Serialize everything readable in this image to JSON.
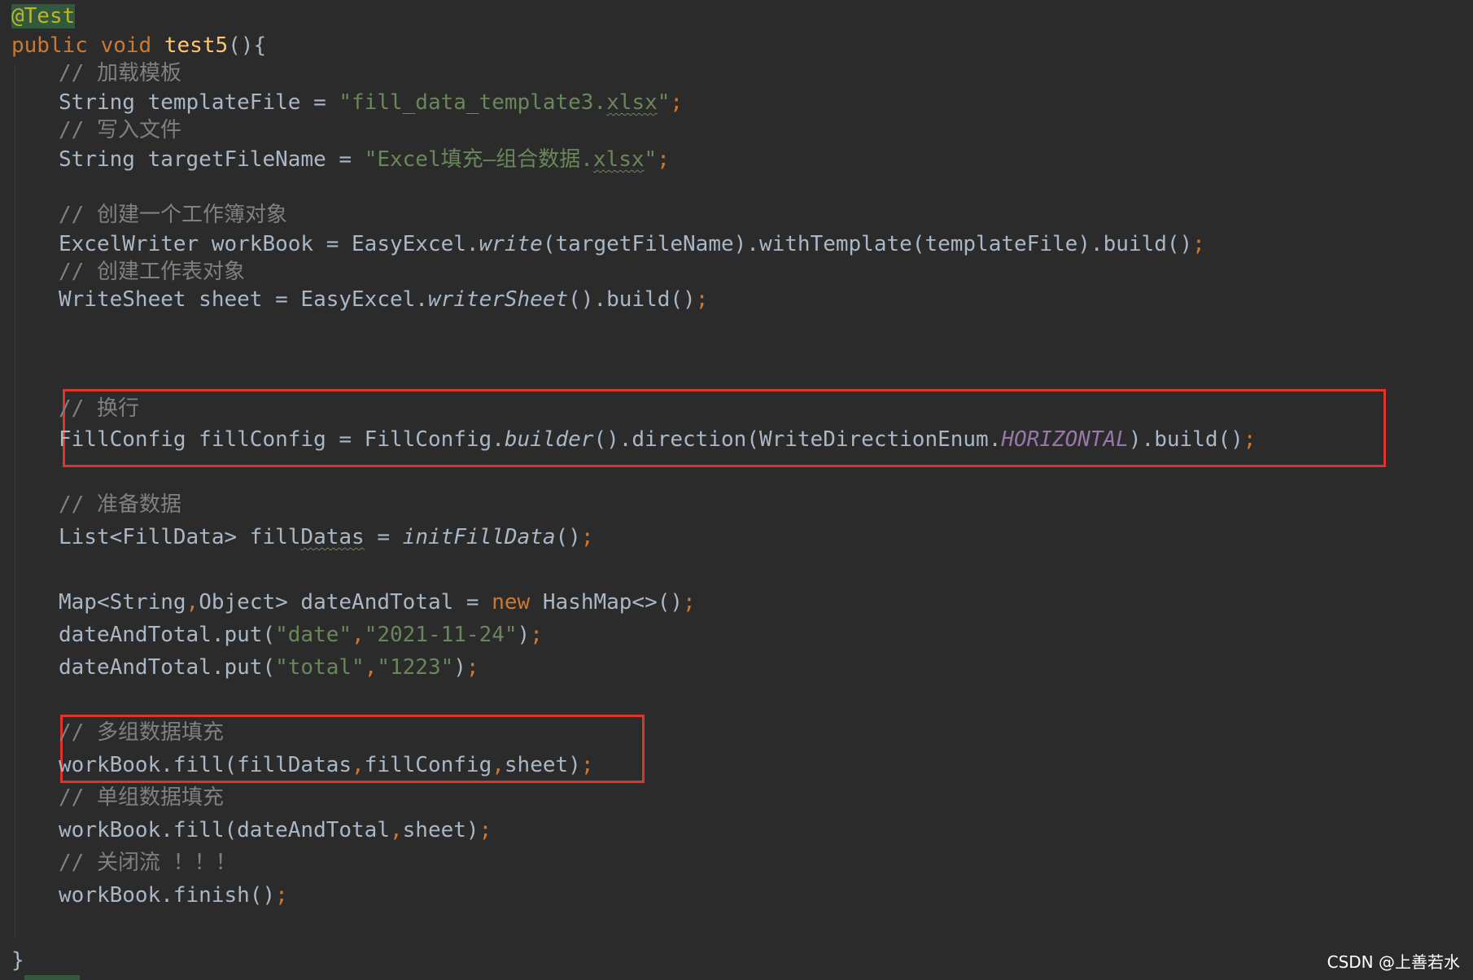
{
  "code": {
    "annotation": "@Test",
    "method_sig": {
      "public": "public",
      "void": "void",
      "name": "test5",
      "open": "(){"
    },
    "line_comment_load_template": "// 加载模板",
    "template_decl": {
      "type": "String templateFile = ",
      "str_a": "\"fill_data_template3.",
      "str_ext": "xlsx",
      "str_end": "\"",
      "semi": ";"
    },
    "line_comment_write_file": "// 写入文件",
    "target_decl": {
      "type": "String targetFileName = ",
      "str_a": "\"Excel填充—组合数据.",
      "str_ext": "xlsx",
      "str_end": "\"",
      "semi": ";"
    },
    "line_comment_create_workbook": "// 创建一个工作簿对象",
    "writer_decl": {
      "pre": "ExcelWriter workBook = EasyExcel.",
      "write": "write",
      "post": "(targetFileName).withTemplate(templateFile).build()",
      "semi": ";"
    },
    "line_comment_create_sheet": "// 创建工作表对象",
    "sheet_decl": {
      "pre": "WriteSheet sheet = EasyExcel.",
      "call": "writerSheet",
      "post": "().build()",
      "semi": ";"
    },
    "line_comment_newline": "// 换行",
    "fillconfig_decl": {
      "pre": "FillConfig fillConfig = FillConfig.",
      "builder": "builder",
      "mid": "().direction(WriteDirectionEnum.",
      "const": "HORIZONTAL",
      "post": ").build()",
      "semi": ";"
    },
    "line_comment_prepare_data": "// 准备数据",
    "list_decl": {
      "pre": "List<FillData> fill",
      "squig": "Datas",
      "mid": " = ",
      "call": "initFillData",
      "post": "()",
      "semi": ";"
    },
    "map_decl": {
      "pre": "Map<String",
      "comma": ",",
      "mid": "Object> dateAndTotal = ",
      "new": "new",
      "post": " HashMap<>()",
      "semi": ";"
    },
    "put_date": {
      "pre": "dateAndTotal.put(",
      "k": "\"date\"",
      "comma": ",",
      "v": "\"2021-11-24\"",
      "post": ")",
      "semi": ";"
    },
    "put_total": {
      "pre": "dateAndTotal.put(",
      "k": "\"total\"",
      "comma": ",",
      "v": "\"1223\"",
      "post": ")",
      "semi": ";"
    },
    "line_comment_multi_fill": "// 多组数据填充",
    "multi_fill": {
      "pre": "workBook.fill(fillDatas",
      "c1": ",",
      "mid": "fillConfig",
      "c2": ",",
      "post": "sheet)",
      "semi": ";"
    },
    "line_comment_single_fill": "// 单组数据填充",
    "single_fill": {
      "pre": "workBook.fill(dateAndTotal",
      "c1": ",",
      "post": "sheet)",
      "semi": ";"
    },
    "line_comment_close": "// 关闭流 ！！！",
    "finish": {
      "pre": "workBook.finish()",
      "semi": ";"
    },
    "closing_brace": "}"
  },
  "watermark": "CSDN @上善若水",
  "colors": {
    "background": "#2b2b2b",
    "default_text": "#a9b7c6",
    "keyword": "#cc7832",
    "method_name": "#ffc66d",
    "string": "#6a8759",
    "comment": "#808080",
    "constant": "#9876aa",
    "annotation": "#bbb529",
    "highlight_box": "#e0332b"
  }
}
